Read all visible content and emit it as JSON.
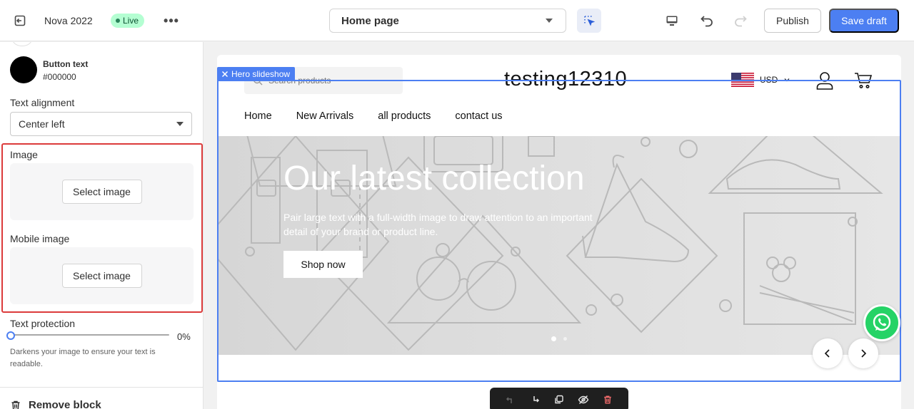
{
  "topbar": {
    "store_name": "Nova 2022",
    "live_label": "Live",
    "more_label": "•••",
    "page_selector": "Home page",
    "publish_label": "Publish",
    "save_label": "Save draft"
  },
  "sidebar": {
    "button_text_color": {
      "title": "Button text",
      "value": "#000000"
    },
    "text_alignment": {
      "label": "Text alignment",
      "selected": "Center left"
    },
    "image": {
      "label": "Image",
      "button": "Select image"
    },
    "mobile_image": {
      "label": "Mobile image",
      "button": "Select image"
    },
    "text_protection": {
      "label": "Text protection",
      "value": "0%",
      "level": 0,
      "help": "Darkens your image to ensure your text is readable."
    },
    "remove_block": "Remove block"
  },
  "preview": {
    "section_tag": "Hero slideshow",
    "search_placeholder": "Search products",
    "store_logo": "testing12310",
    "currency": "USD",
    "nav": [
      "Home",
      "New Arrivals",
      "all products",
      "contact us"
    ],
    "hero": {
      "title": "Our latest collection",
      "text": "Pair large text with a full-width image to draw attention to an important detail of your brand or product line.",
      "button": "Shop now"
    }
  },
  "colors": {
    "accent": "#4c7ff2",
    "highlight": "#dc3b3b",
    "live_badge": "#b4fed2",
    "whatsapp": "#25d366",
    "swatch": "#000000"
  },
  "icons": [
    "exit-icon",
    "more-icon",
    "chevron-down-icon",
    "inspector-icon",
    "desktop-icon",
    "undo-icon",
    "redo-icon",
    "search-icon",
    "flag-us-icon",
    "account-icon",
    "cart-icon",
    "chevron-left-icon",
    "chevron-right-icon",
    "close-icon",
    "whatsapp-icon",
    "trash-icon",
    "move-up-icon",
    "move-down-icon",
    "duplicate-icon",
    "hide-icon"
  ]
}
